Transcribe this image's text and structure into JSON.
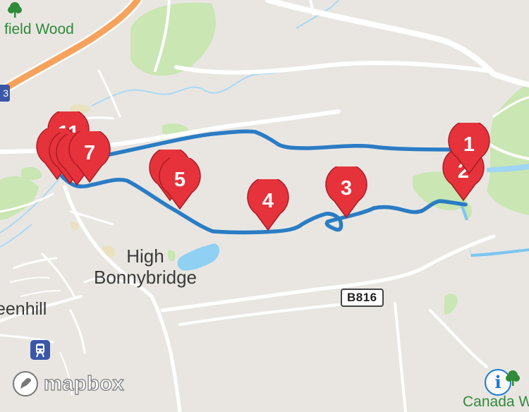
{
  "map": {
    "places": {
      "wood": "field Wood",
      "town": "High\nBonnybridge",
      "town_line1": "High",
      "town_line2": "Bonnybridge",
      "town_left": "eenhill",
      "canada": "Canada W"
    },
    "road_shield": "B816",
    "edge_shield": "3",
    "attribution": "mapbox",
    "info_glyph": "i",
    "markers": [
      "11",
      "1",
      "7",
      "5",
      "4",
      "3",
      "2",
      "1"
    ],
    "colors": {
      "route": "#2a7cc4",
      "marker": "#e5323b",
      "park": "#c9e6b3",
      "water": "#62b8e8",
      "motorway": "#f7a25c",
      "land": "#e9e6e2"
    },
    "icons": {
      "tree": "tree-icon",
      "rail": "rail-station-icon",
      "mapbox": "mapbox-logo-icon",
      "info": "info-icon"
    }
  }
}
